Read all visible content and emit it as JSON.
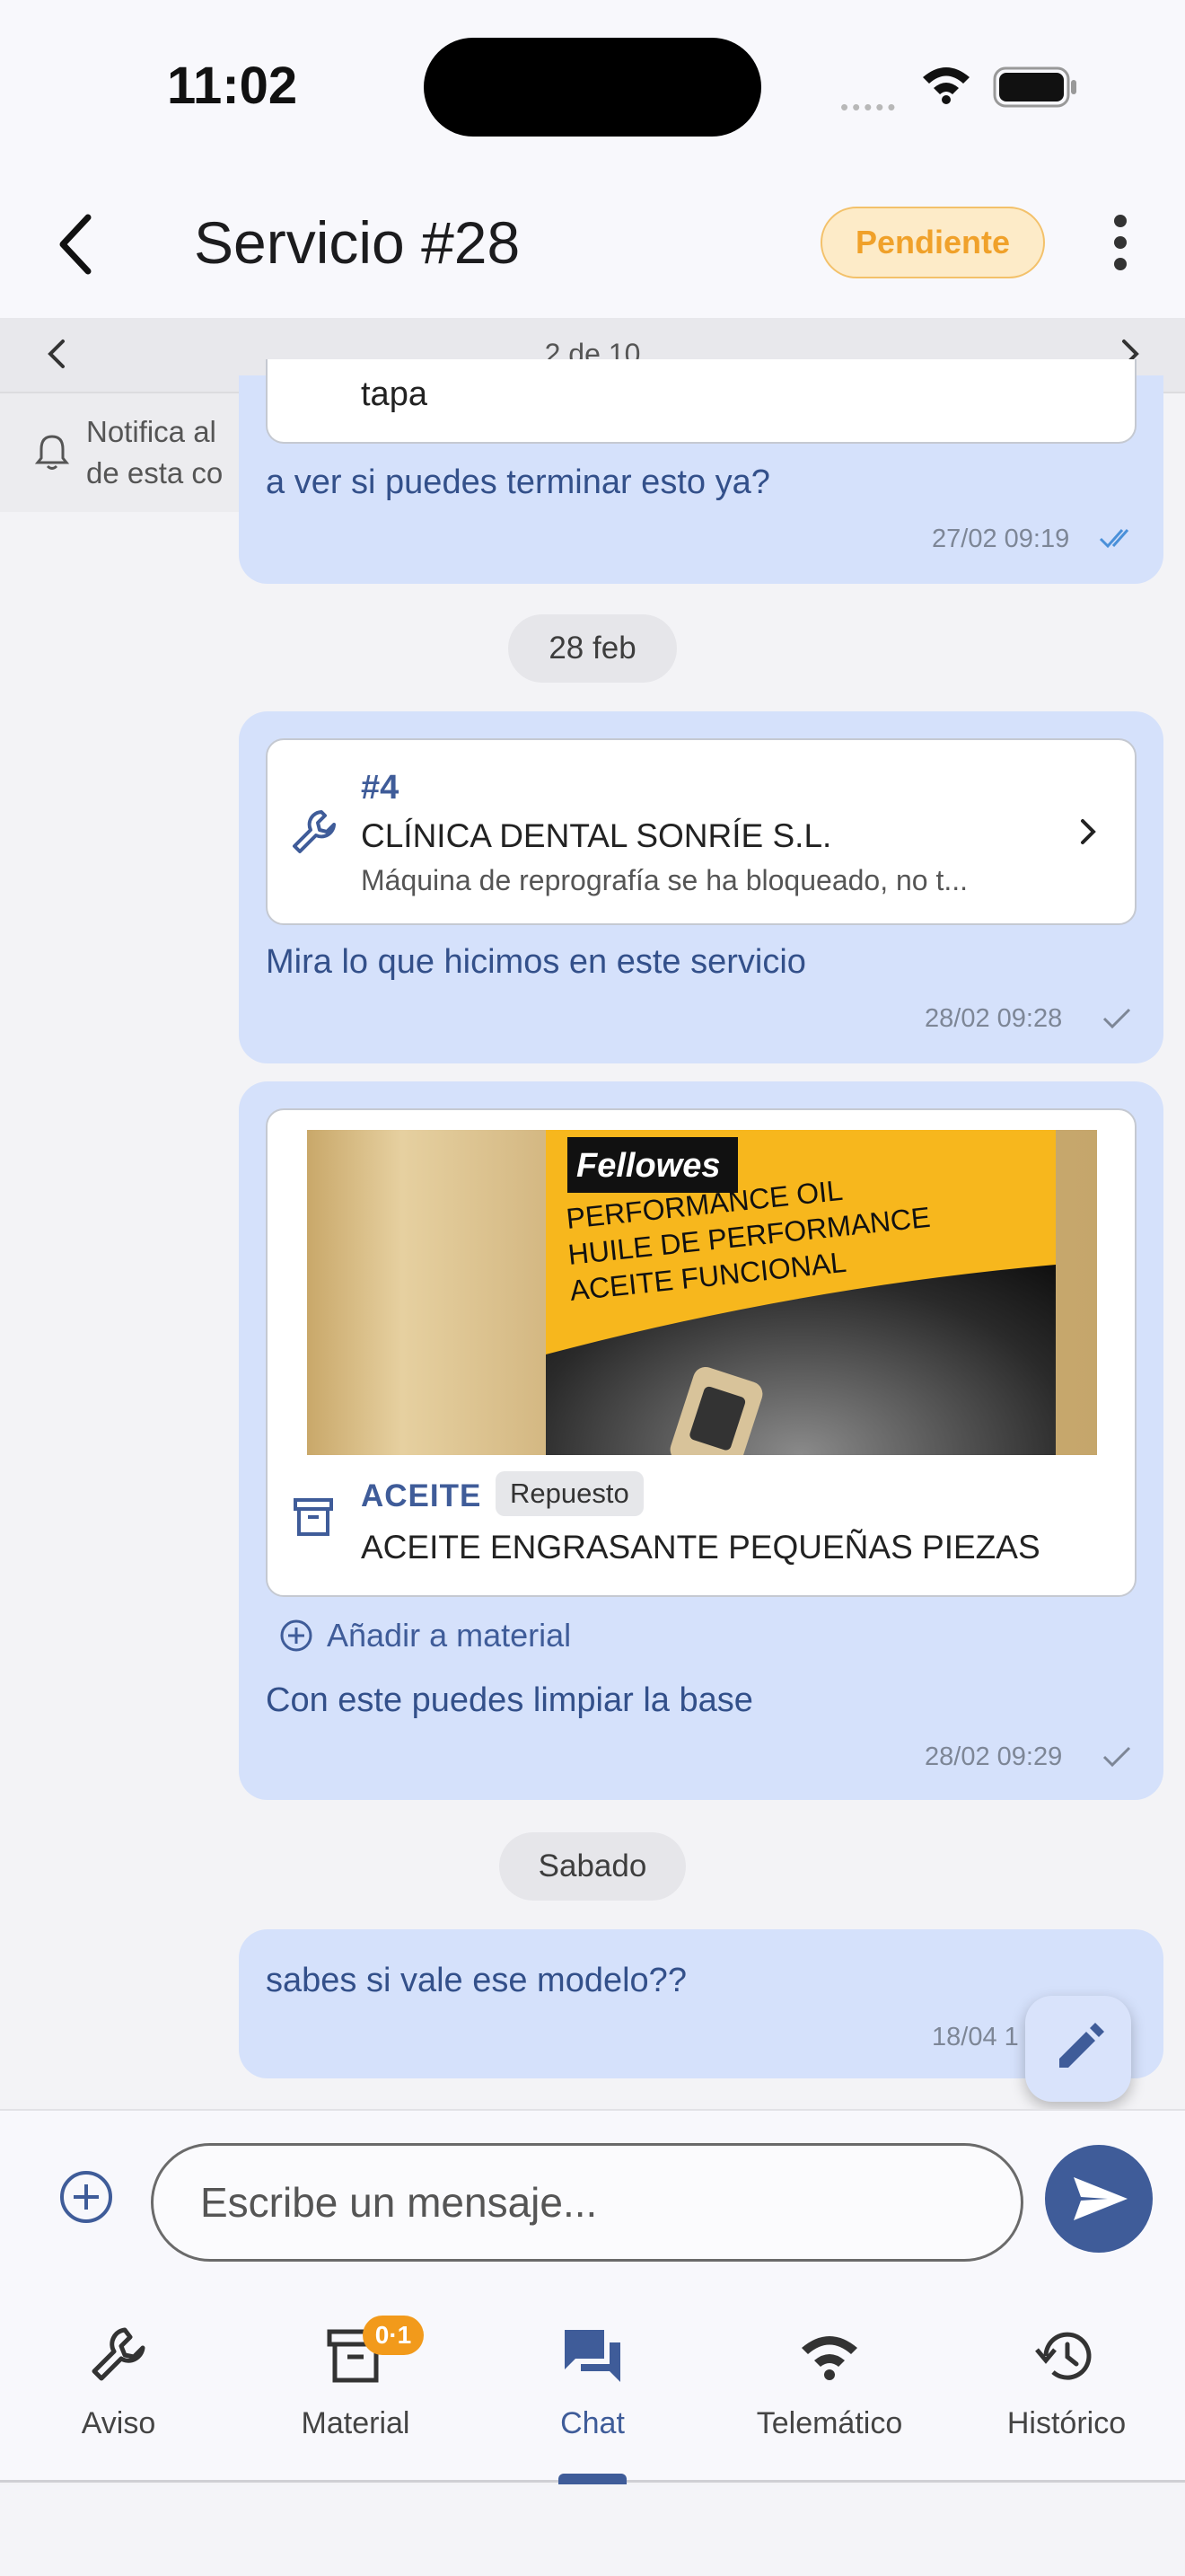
{
  "status_bar": {
    "time": "11:02"
  },
  "header": {
    "title": "Servicio #28",
    "status": "Pendiente"
  },
  "pager": {
    "label": "2 de 10"
  },
  "notification": {
    "line1": "Notifica al",
    "line2": "de esta co"
  },
  "messages": {
    "m1": {
      "card_text": "tapa",
      "text": "a ver si puedes terminar esto ya?",
      "time": "27/02 09:19"
    },
    "date1": "28 feb",
    "m2": {
      "service_number": "#4",
      "service_client": "CLÍNICA DENTAL SONRÍE S.L.",
      "service_desc": "Máquina de reprografía se ha bloqueado, no t...",
      "text": "Mira lo que hicimos en este servicio",
      "time": "28/02 09:28"
    },
    "m3": {
      "product_image": {
        "brand": "Fellowes",
        "line1": "PERFORMANCE OIL",
        "line2": "HUILE DE PERFORMANCE",
        "line3": "ACEITE FUNCIONAL"
      },
      "product_code": "ACEITE",
      "product_tag": "Repuesto",
      "product_name": "ACEITE ENGRASANTE PEQUEÑAS PIEZAS",
      "add_label": "Añadir a material",
      "text": "Con este puedes limpiar la base",
      "time": "28/02 09:29"
    },
    "date2": "Sabado",
    "m4": {
      "text": "sabes si vale ese modelo??",
      "time": "18/04 1"
    }
  },
  "composer": {
    "placeholder": "Escribe un mensaje..."
  },
  "nav": {
    "items": [
      {
        "label": "Aviso",
        "icon": "wrench-icon"
      },
      {
        "label": "Material",
        "icon": "archive-icon",
        "badge": "0·1"
      },
      {
        "label": "Chat",
        "icon": "chat-icon"
      },
      {
        "label": "Telemático",
        "icon": "wifi-icon"
      },
      {
        "label": "Histórico",
        "icon": "history-icon"
      }
    ],
    "active": "Chat"
  },
  "colors": {
    "accent": "#3f5c99",
    "bubble": "#d5e1fb",
    "pending": "#f0a12a",
    "badge": "#f29a1b"
  }
}
